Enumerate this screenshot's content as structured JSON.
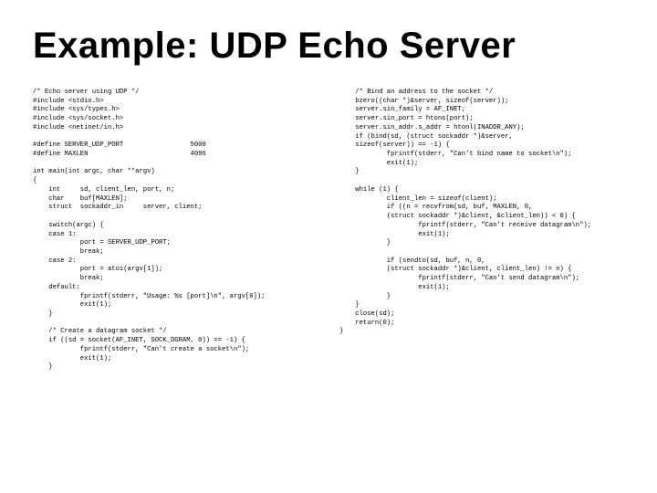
{
  "title": "Example: UDP Echo Server",
  "code": {
    "left": "/* Echo server using UDP */\n#include <stdio.h>\n#include <sys/types.h>\n#include <sys/socket.h>\n#include <netinet/in.h>\n\n#define SERVER_UDP_PORT                 5000\n#define MAXLEN                          4096\n\nint main(int argc, char **argv)\n{\n    int     sd, client_len, port, n;\n    char    buf[MAXLEN];\n    struct  sockaddr_in     server, client;\n\n    switch(argc) {\n    case 1:\n            port = SERVER_UDP_PORT;\n            break;\n    case 2:\n            port = atoi(argv[1]);\n            break;\n    default:\n            fprintf(stderr, \"Usage: %s [port]\\n\", argv[0]);\n            exit(1);\n    }\n\n    /* Create a datagram socket */\n    if ((sd = socket(AF_INET, SOCK_DGRAM, 0)) == -1) {\n            fprintf(stderr, \"Can't create a socket\\n\");\n            exit(1);\n    }",
    "right": "    /* Bind an address to the socket */\n    bzero((char *)&server, sizeof(server));\n    server.sin_family = AF_INET;\n    server.sin_port = htons(port);\n    server.sin_addr.s_addr = htonl(INADDR_ANY);\n    if (bind(sd, (struct sockaddr *)&server,\n    sizeof(server)) == -1) {\n            fprintf(stderr, \"Can't bind name to socket\\n\");\n            exit(1);\n    }\n\n    while (1) {\n            client_len = sizeof(client);\n            if ((n = recvfrom(sd, buf, MAXLEN, 0,\n            (struct sockaddr *)&client, &client_len)) < 0) {\n                    fprintf(stderr, \"Can't receive datagram\\n\");\n                    exit(1);\n            }\n\n            if (sendto(sd, buf, n, 0,\n            (struct sockaddr *)&client, client_len) != n) {\n                    fprintf(stderr, \"Can't send datagram\\n\");\n                    exit(1);\n            }\n    }\n    close(sd);\n    return(0);\n}"
  }
}
